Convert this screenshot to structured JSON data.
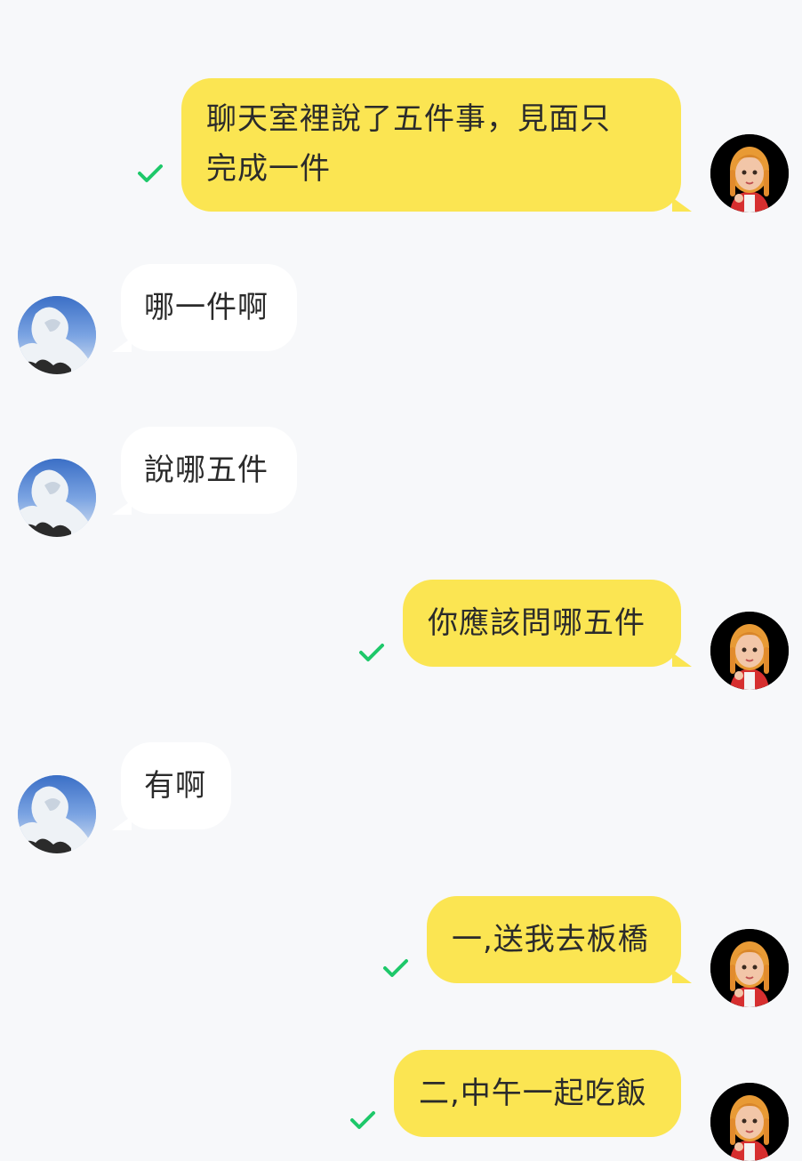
{
  "messages": [
    {
      "id": 1,
      "side": "out",
      "text": "聊天室裡說了五件事，見面只完成一件",
      "line1": "聊天室裡說了五件事，見面只",
      "line2": "完成一件",
      "status": "read-check"
    },
    {
      "id": 2,
      "side": "in",
      "text": "哪一件啊"
    },
    {
      "id": 3,
      "side": "in",
      "text": "說哪五件"
    },
    {
      "id": 4,
      "side": "out",
      "text": "你應該問哪五件",
      "status": "read-check"
    },
    {
      "id": 5,
      "side": "in",
      "text": "有啊"
    },
    {
      "id": 6,
      "side": "out",
      "text": "一,送我去板橋",
      "status": "read-check"
    },
    {
      "id": 7,
      "side": "out",
      "text": "二,中午一起吃飯",
      "status": "read-check"
    }
  ],
  "icons": {
    "check": "check-icon",
    "me_avatar": "user-avatar-girl",
    "other_avatar": "user-avatar-sky"
  },
  "colors": {
    "background": "#f7f8fa",
    "out_bubble": "#fbe552",
    "in_bubble": "#ffffff",
    "check": "#1ec86a"
  }
}
